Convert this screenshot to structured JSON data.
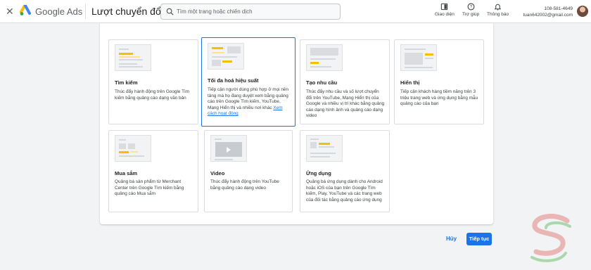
{
  "header": {
    "close_label": "✕",
    "brand": "Google Ads",
    "page_title": "Lượt chuyển đổi",
    "search_placeholder": "Tìm một trang hoặc chiến dịch",
    "tools": [
      {
        "label": "Giao diện",
        "icon": "appearance-icon"
      },
      {
        "label": "Trợ giúp",
        "icon": "help-icon"
      },
      {
        "label": "Thông báo",
        "icon": "bell-icon"
      }
    ],
    "account_id": "108-581-4649",
    "account_email": "tuan642002@gmail.com"
  },
  "cards": [
    {
      "title": "Tìm kiếm",
      "desc": "Thúc đẩy hành động trên Google Tìm kiếm bằng quảng cáo dạng văn bản",
      "thumb": "search"
    },
    {
      "title": "Tối đa hoá hiệu suất",
      "desc": "Tiếp cận người dùng phù hợp ở mọi nền tảng mà họ đang duyệt xem bằng quảng cáo trên Google Tìm kiếm, YouTube, Mạng Hiển thị và nhiều nơi khác",
      "link": "Xem cách hoạt động",
      "selected": true,
      "thumb": "pmax"
    },
    {
      "title": "Tạo nhu cầu",
      "desc": "Thúc đẩy nhu cầu và số lượt chuyển đổi trên YouTube, Mạng Hiển thị của Google và nhiều vị trí khác bằng quảng cáo dạng hình ảnh và quảng cáo dạng video",
      "thumb": "demand"
    },
    {
      "title": "Hiển thị",
      "desc": "Tiếp cận khách hàng tiềm năng trên 3 triệu trang web và ứng dụng bằng mẫu quảng cáo của bạn",
      "thumb": "display"
    },
    {
      "title": "Mua sắm",
      "desc": "Quảng bá sản phẩm từ Merchant Center trên Google Tìm kiếm bằng quảng cáo Mua sắm",
      "thumb": "shopping"
    },
    {
      "title": "Video",
      "desc": "Thúc đẩy hành động trên YouTube bằng quảng cáo dạng video",
      "thumb": "video"
    },
    {
      "title": "Ứng dụng",
      "desc": "Quảng bá ứng dụng dành cho Android hoặc iOS của bạn trên Google Tìm kiếm, Play, YouTube và các trang web của đối tác bằng quảng cáo ứng dụng",
      "thumb": "app"
    }
  ],
  "footer": {
    "cancel": "Hủy",
    "next": "Tiếp tục"
  },
  "colors": {
    "accent": "#1a73e8",
    "brand_yellow": "#fbbc04"
  }
}
